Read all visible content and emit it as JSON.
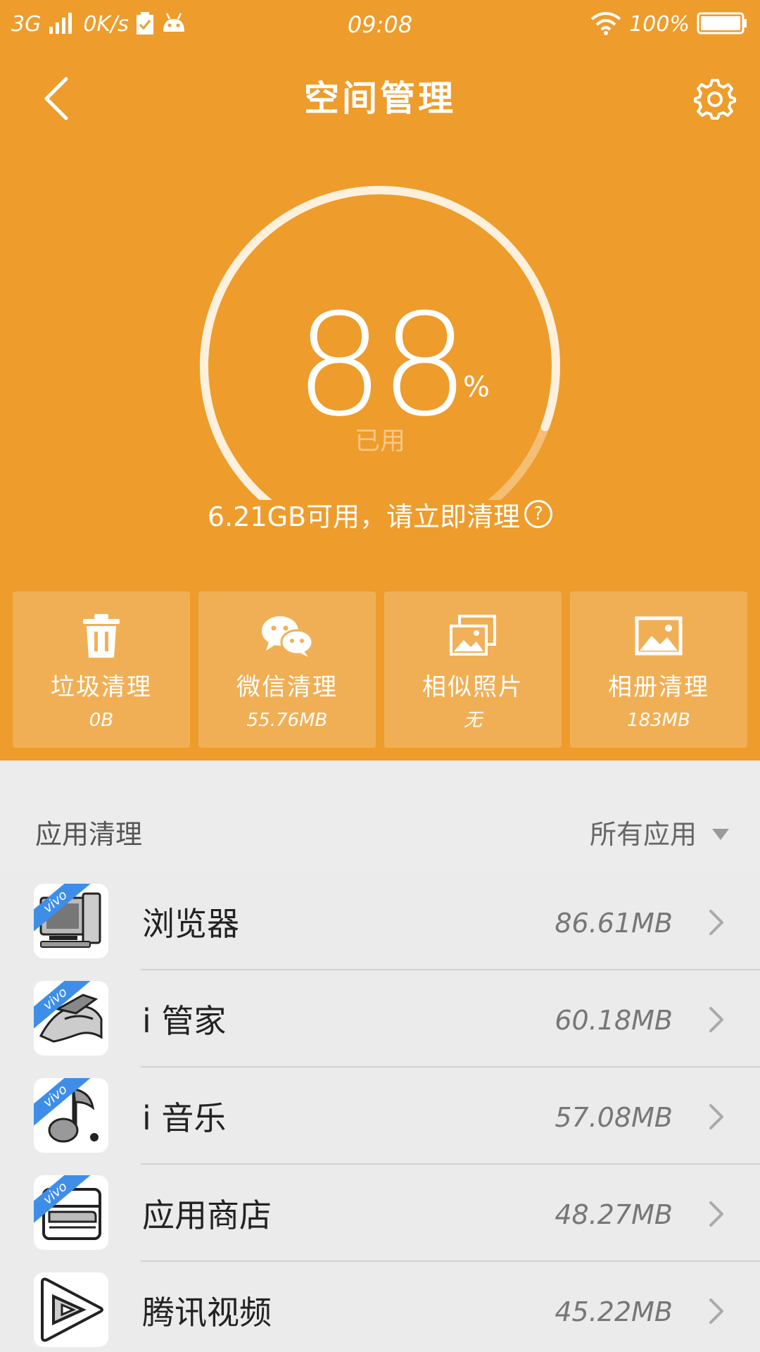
{
  "status_bar": {
    "network": "3G",
    "speed": "0K/s",
    "time": "09:08",
    "battery": "100%"
  },
  "header": {
    "title": "空间管理"
  },
  "gauge": {
    "percent_used": 88,
    "value_text": "88",
    "unit": "%",
    "label": "已用"
  },
  "storage_note": "6.21GB可用，请立即清理",
  "tiles": [
    {
      "name": "垃圾清理",
      "value": "0B",
      "icon": "trash-icon"
    },
    {
      "name": "微信清理",
      "value": "55.76MB",
      "icon": "wechat-icon"
    },
    {
      "name": "相似照片",
      "value": "无",
      "icon": "similar-photos-icon"
    },
    {
      "name": "相册清理",
      "value": "183MB",
      "icon": "album-icon"
    }
  ],
  "app_section": {
    "title": "应用清理",
    "filter_label": "所有应用"
  },
  "apps": [
    {
      "name": "浏览器",
      "size": "86.61MB",
      "icon": "browser-icon",
      "badge": "vivo"
    },
    {
      "name": "i 管家",
      "size": "60.18MB",
      "icon": "imanager-icon",
      "badge": "vivo"
    },
    {
      "name": "i 音乐",
      "size": "57.08MB",
      "icon": "imusic-icon",
      "badge": "vivo"
    },
    {
      "name": "应用商店",
      "size": "48.27MB",
      "icon": "app-store-icon",
      "badge": "vivo"
    },
    {
      "name": "腾讯视频",
      "size": "45.22MB",
      "icon": "tencent-video-icon",
      "badge": ""
    }
  ],
  "colors": {
    "accent": "#EE9C2B",
    "tile_bg": "#F1B059",
    "list_bg": "#EBEBEB",
    "vivo_badge": "#3E8EE8"
  }
}
